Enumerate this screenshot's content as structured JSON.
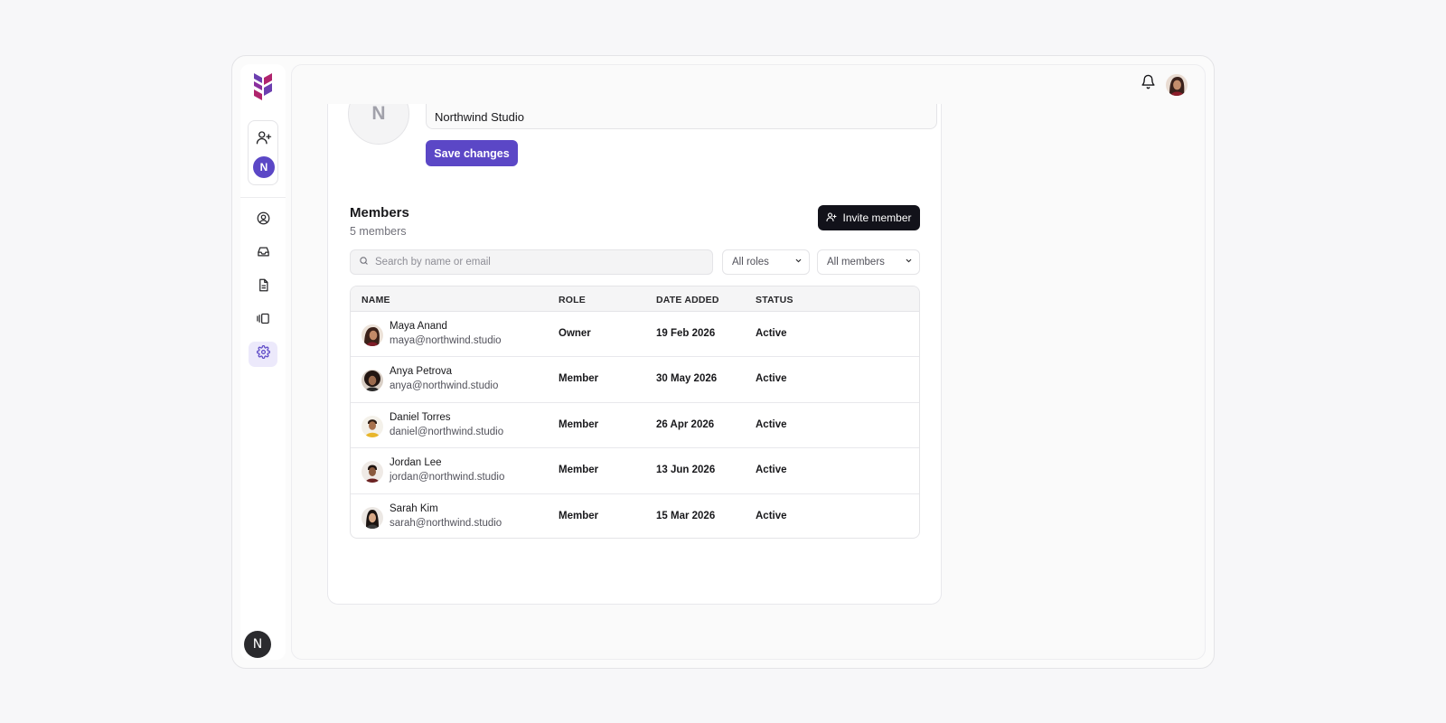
{
  "colors": {
    "accent": "#5b47c6",
    "accent_soft": "#ece9fb",
    "dark_button": "#12121a",
    "logo_purple": "#6c3fb0",
    "logo_magenta": "#b0246d"
  },
  "sidebar": {
    "logo_icon": "brand-logo-icon",
    "workspace_add_icon": "user-plus-icon",
    "workspace_initial": "N",
    "nav_items": [
      {
        "name": "profile",
        "icon": "user-circle-icon",
        "active": false
      },
      {
        "name": "inbox",
        "icon": "inbox-icon",
        "active": false
      },
      {
        "name": "documents",
        "icon": "document-icon",
        "active": false
      },
      {
        "name": "boards",
        "icon": "carousel-icon",
        "active": false
      },
      {
        "name": "settings",
        "icon": "gear-icon",
        "active": true
      }
    ],
    "user_badge": "N"
  },
  "header": {
    "bell_icon": "bell-icon"
  },
  "organization": {
    "avatar_initial": "N",
    "name_value": "Northwind Studio",
    "save_label": "Save changes"
  },
  "members": {
    "title": "Members",
    "count_label": "5 members",
    "invite_label": "Invite member",
    "search_placeholder": "Search by name or email",
    "role_filter": "All roles",
    "status_filter": "All members",
    "columns": {
      "name": "NAME",
      "role": "ROLE",
      "date_added": "DATE ADDED",
      "status": "STATUS"
    },
    "rows": [
      {
        "name": "Maya Anand",
        "email": "maya@northwind.studio",
        "role": "Owner",
        "date": "19 Feb 2026",
        "status": "Active"
      },
      {
        "name": "Anya Petrova",
        "email": "anya@northwind.studio",
        "role": "Member",
        "date": "30 May 2026",
        "status": "Active"
      },
      {
        "name": "Daniel Torres",
        "email": "daniel@northwind.studio",
        "role": "Member",
        "date": "26 Apr 2026",
        "status": "Active"
      },
      {
        "name": "Jordan Lee",
        "email": "jordan@northwind.studio",
        "role": "Member",
        "date": "13 Jun 2026",
        "status": "Active"
      },
      {
        "name": "Sarah Kim",
        "email": "sarah@northwind.studio",
        "role": "Member",
        "date": "15 Mar 2026",
        "status": "Active"
      }
    ]
  }
}
